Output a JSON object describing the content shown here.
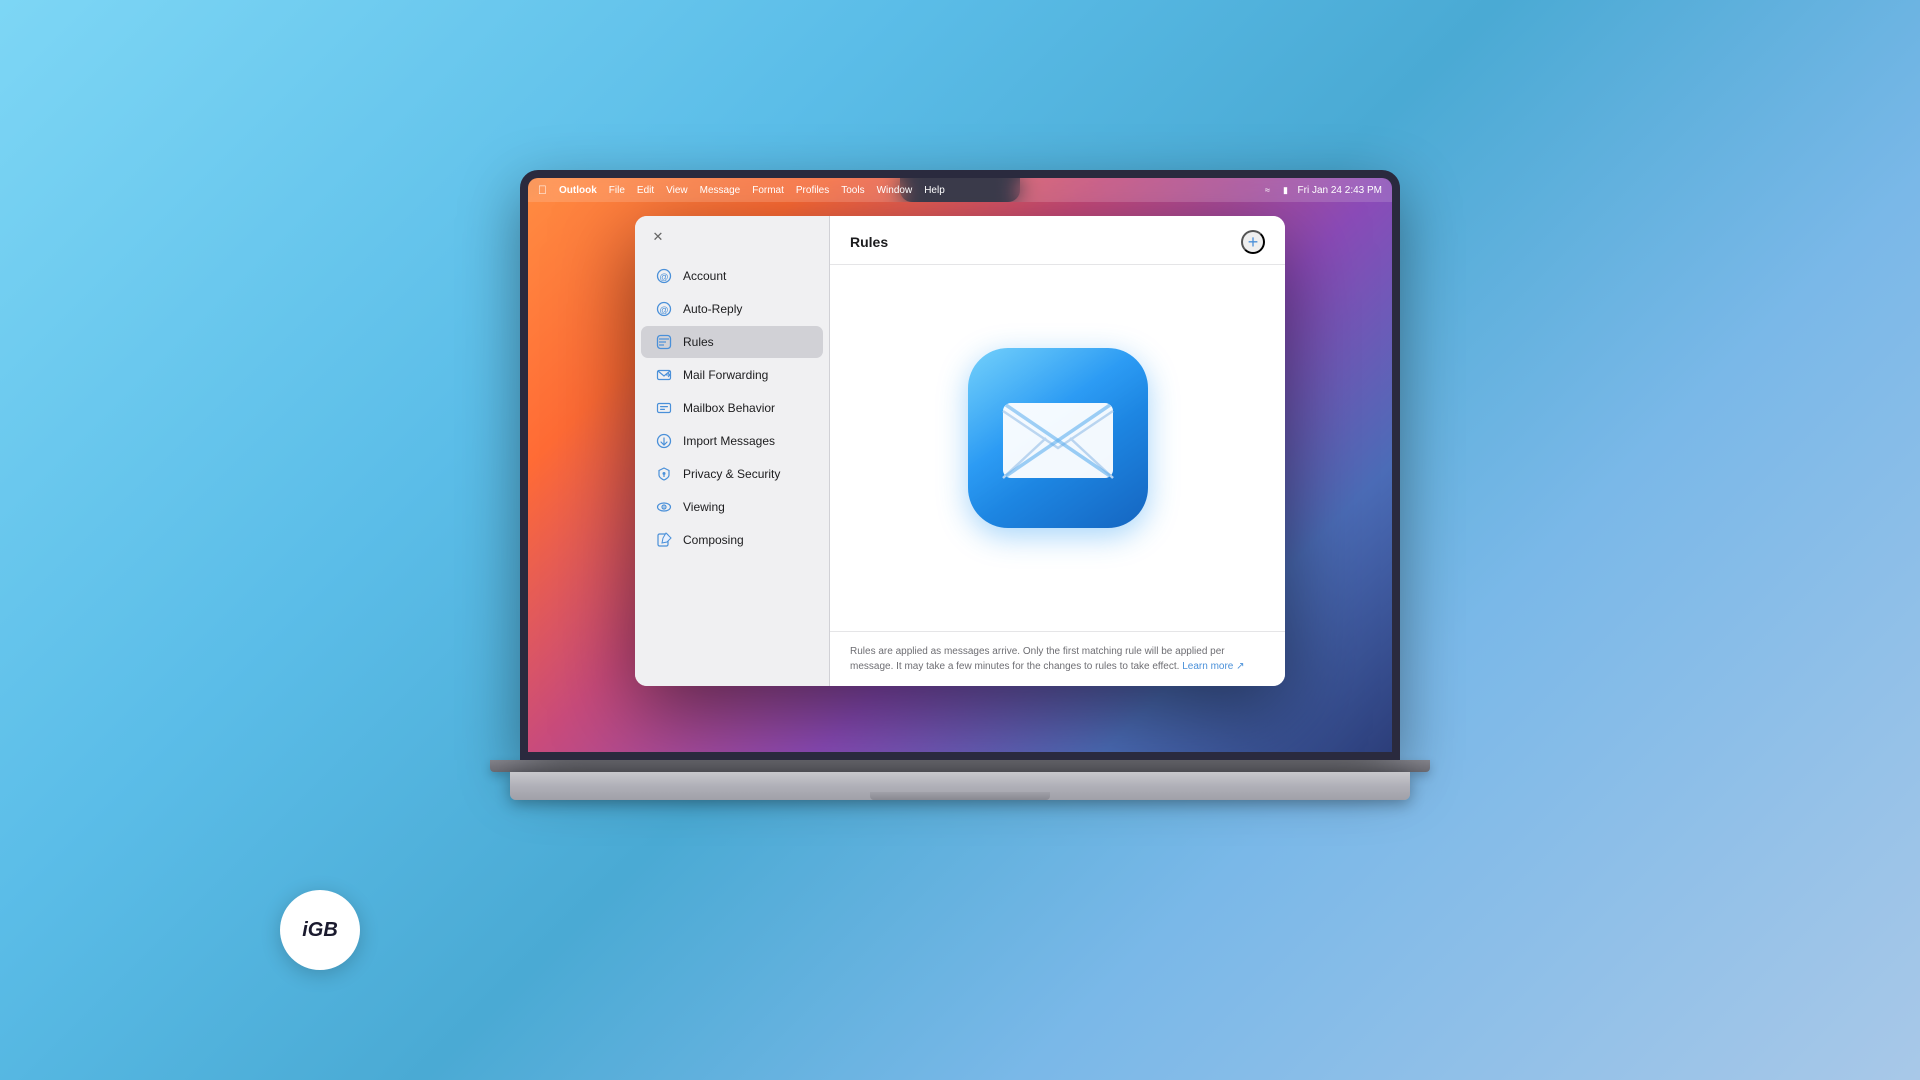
{
  "app": {
    "title": "Outlook",
    "menuItems": [
      "File",
      "Edit",
      "View",
      "Message",
      "Format",
      "Profiles",
      "Tools",
      "Window",
      "Help"
    ],
    "datetime": "Fri Jan 24  2:43 PM"
  },
  "dialog": {
    "title": "Rules",
    "addButton": "+"
  },
  "sidebar": {
    "items": [
      {
        "id": "account",
        "label": "Account",
        "iconType": "at"
      },
      {
        "id": "auto-reply",
        "label": "Auto-Reply",
        "iconType": "at"
      },
      {
        "id": "rules",
        "label": "Rules",
        "iconType": "rules",
        "active": true
      },
      {
        "id": "mail-forwarding",
        "label": "Mail Forwarding",
        "iconType": "forward"
      },
      {
        "id": "mailbox-behavior",
        "label": "Mailbox Behavior",
        "iconType": "mailbox"
      },
      {
        "id": "import-messages",
        "label": "Import Messages",
        "iconType": "import"
      },
      {
        "id": "privacy-security",
        "label": "Privacy & Security",
        "iconType": "privacy"
      },
      {
        "id": "viewing",
        "label": "Viewing",
        "iconType": "viewing"
      },
      {
        "id": "composing",
        "label": "Composing",
        "iconType": "composing"
      }
    ]
  },
  "footer": {
    "text": "Rules are applied as messages arrive. Only the first matching rule will be applied per message. It may take a few minutes for the changes to rules to take effect.",
    "linkText": "Learn more ↗"
  },
  "igb": {
    "label": "iGB"
  }
}
